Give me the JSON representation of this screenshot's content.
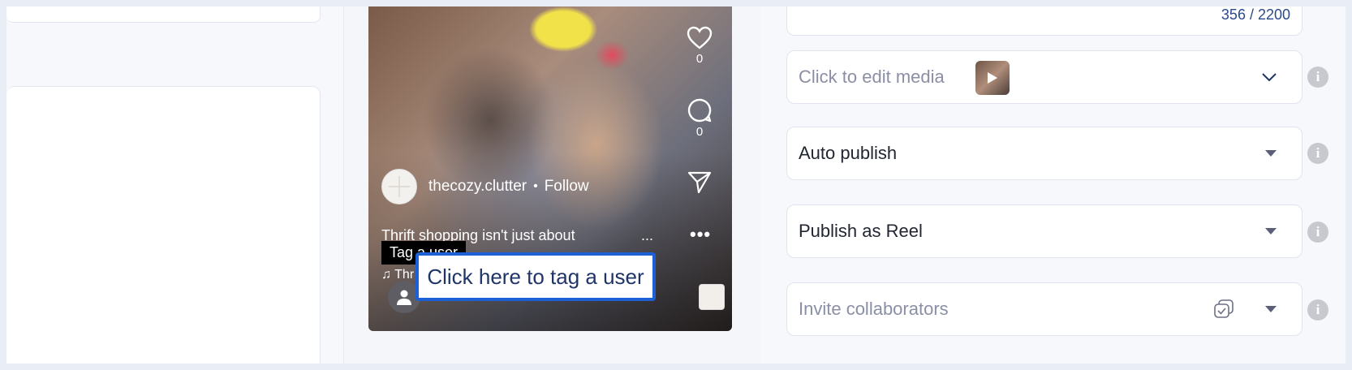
{
  "preview": {
    "likes": "0",
    "comments": "0",
    "username": "thecozy.clutter",
    "separator": "•",
    "follow": "Follow",
    "caption": "Thrift shopping isn't just about",
    "caption_more": "...",
    "more": "•••",
    "music_note": "♫ Thr",
    "tag_label": "Tag a user",
    "tag_prompt": "Click here to tag a user"
  },
  "form": {
    "caption_counter": "356 / 2200",
    "edit_media": "Click to edit media",
    "publish_mode": "Auto publish",
    "publish_type": "Publish as Reel",
    "collaborators_placeholder": "Invite collaborators",
    "info": "i"
  }
}
